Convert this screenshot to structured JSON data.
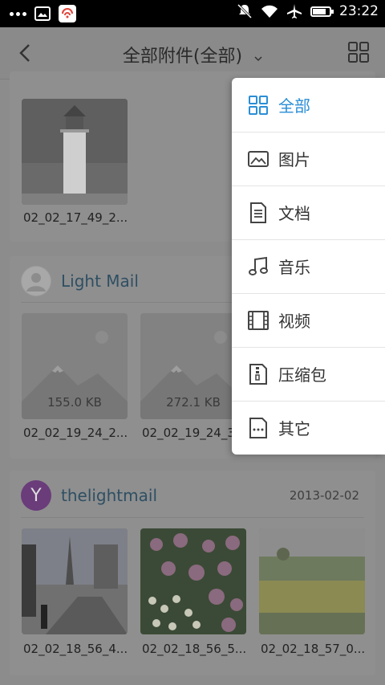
{
  "status_bar": {
    "time": "23:22",
    "battery_level": 0.8,
    "icons": [
      "more-dots-icon",
      "gallery-icon",
      "app-icon",
      "mute-icon",
      "wifi-icon",
      "airplane-icon",
      "battery-icon"
    ]
  },
  "header": {
    "title": "全部附件(全部)",
    "back_icon": "back-icon",
    "dropdown_icon": "chevron-down-icon",
    "grid_icon": "grid-view-icon"
  },
  "cards": [
    {
      "attachments": [
        {
          "filename": "02_02_17_49_2...",
          "kind": "photo-lighthouse"
        }
      ]
    },
    {
      "sender": "Light Mail",
      "avatar": "default-avatar-icon",
      "attachments": [
        {
          "filename": "02_02_19_24_2...",
          "size": "155.0 KB",
          "kind": "image-placeholder"
        },
        {
          "filename": "02_02_19_24_3...",
          "size": "272.1 KB",
          "kind": "image-placeholder"
        }
      ]
    },
    {
      "sender": "thelightmail",
      "avatar_letter": "Y",
      "avatar_color": "#6a3c7a",
      "date": "2013-02-02",
      "attachments": [
        {
          "filename": "02_02_18_56_4...",
          "kind": "photo-street"
        },
        {
          "filename": "02_02_18_56_5...",
          "kind": "photo-flowers"
        },
        {
          "filename": "02_02_18_57_0...",
          "kind": "photo-field"
        }
      ]
    }
  ],
  "filter_menu": {
    "accent": "#2a8ed6",
    "items": [
      {
        "label": "全部",
        "icon": "grid-icon",
        "active": true
      },
      {
        "label": "图片",
        "icon": "image-icon",
        "active": false
      },
      {
        "label": "文档",
        "icon": "document-icon",
        "active": false
      },
      {
        "label": "音乐",
        "icon": "music-icon",
        "active": false
      },
      {
        "label": "视频",
        "icon": "film-icon",
        "active": false
      },
      {
        "label": "压缩包",
        "icon": "archive-icon",
        "active": false
      },
      {
        "label": "其它",
        "icon": "other-file-icon",
        "active": false
      }
    ]
  }
}
